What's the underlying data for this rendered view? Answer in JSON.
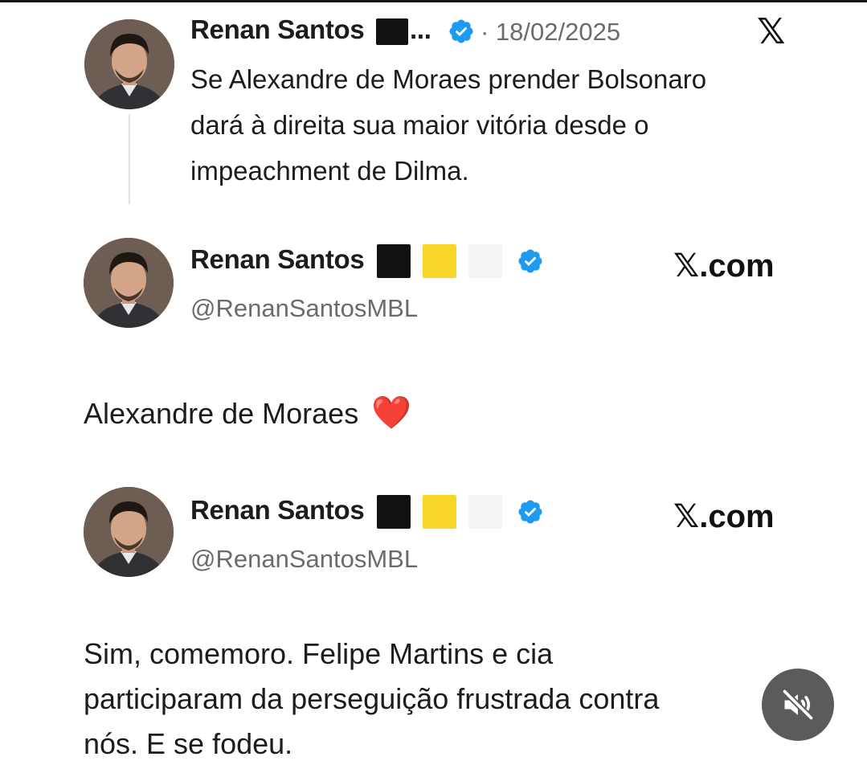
{
  "tweet1": {
    "author_name": "Renan Santos",
    "name_suffix": "...",
    "date": "· 18/02/2025",
    "x_logo": "𝕏",
    "lines": [
      "Se Alexandre de Moraes prender Bolsonaro",
      "dará à direita sua maior vitória desde o",
      "impeachment de Dilma."
    ]
  },
  "tweet2": {
    "author_name": "Renan Santos",
    "handle": "@RenanSantosMBL",
    "source": "𝕏.com",
    "text": "Alexandre de Moraes",
    "emoji": "❤️"
  },
  "tweet3": {
    "author_name": "Renan Santos",
    "handle": "@RenanSantosMBL",
    "source": "𝕏.com",
    "lines": [
      "Sim, comemoro. Felipe Martins e cia",
      "participaram da perseguição frustrada contra",
      "nós. E se fodeu."
    ]
  },
  "colors": {
    "verified": "#1d9bf0",
    "flag_black": "#111111",
    "flag_yellow": "#f7d628",
    "flag_white": "#f4f4f4",
    "mute_button": "#5b5b5b"
  },
  "icons": {
    "verified": "verified-badge-icon",
    "mute": "speaker-muted-icon"
  }
}
